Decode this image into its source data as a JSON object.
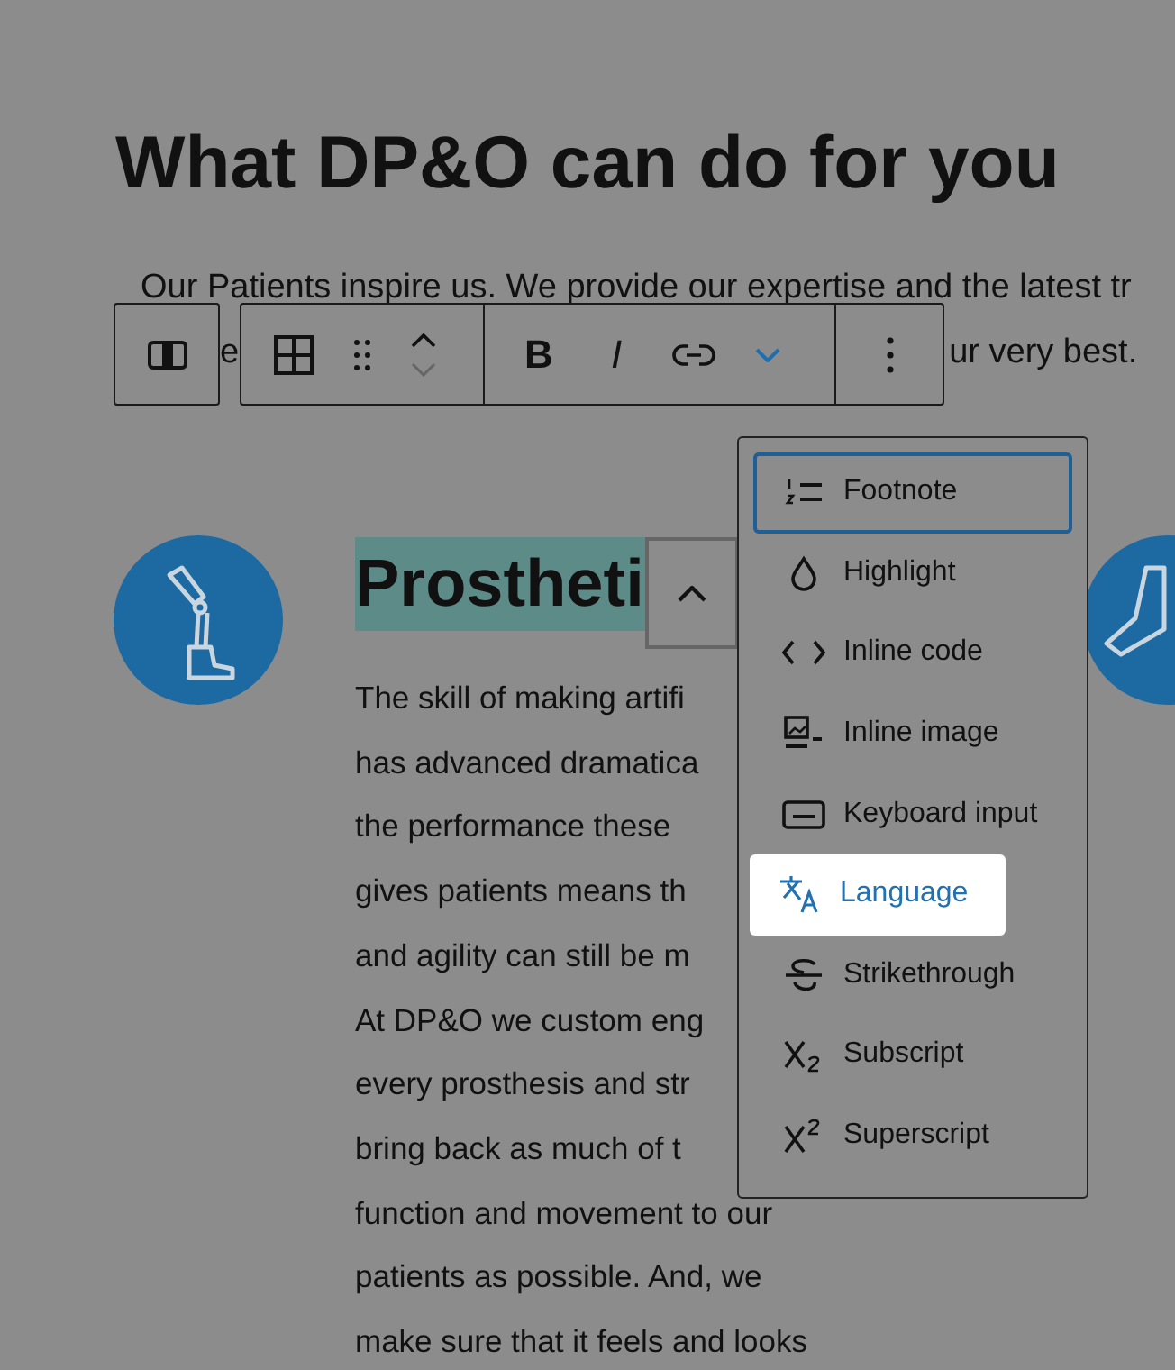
{
  "heading": "What DP&O can do for you",
  "intro": {
    "line_1": "Our Patients inspire us. We provide our expertise and the latest tr",
    "line_2_parts": [
      "e",
      "ur very best."
    ]
  },
  "block_toolbar": {
    "bold": "B",
    "italic": "I",
    "more_formats": {
      "expanded": true
    }
  },
  "section_heading": {
    "text": "Prostheti",
    "highlighted": true
  },
  "body_lines": [
    "The skill of making artifi",
    "has advanced dramatica",
    "the performance these",
    "gives patients means th",
    "and agility can still be m",
    "At DP&O we custom eng",
    "every prosthesis and str",
    "bring back as much of t",
    "function and movement to our",
    "patients as possible. And, we",
    "make sure that it feels and looks"
  ],
  "format_menu": {
    "items": [
      {
        "label": "Footnote",
        "selected": false,
        "focused": true
      },
      {
        "label": "Highlight",
        "selected": false,
        "focused": false
      },
      {
        "label": "Inline code",
        "selected": false,
        "focused": false
      },
      {
        "label": "Inline image",
        "selected": false,
        "focused": false
      },
      {
        "label": "Keyboard input",
        "selected": false,
        "focused": false
      },
      {
        "label": "Language",
        "selected": true,
        "focused": false
      },
      {
        "label": "Strikethrough",
        "selected": false,
        "focused": false
      },
      {
        "label": "Subscript",
        "selected": false,
        "focused": false
      },
      {
        "label": "Superscript",
        "selected": false,
        "focused": false
      }
    ]
  }
}
